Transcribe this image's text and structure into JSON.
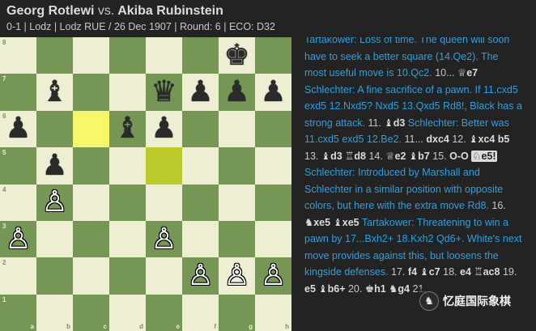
{
  "header": {
    "white": "Georg Rotlewi",
    "vs": "vs.",
    "black": "Akiba Rubinstein",
    "meta": "0-1 | Lodz | Lodz RUE / 26 Dec 1907 | Round: 6 | ECO: D32"
  },
  "board": {
    "ranks": [
      "8",
      "7",
      "6",
      "5",
      "4",
      "3",
      "2",
      "1"
    ],
    "files": [
      "a",
      "b",
      "c",
      "d",
      "e",
      "f",
      "g",
      "h"
    ],
    "highlighted": [
      "c6",
      "e5"
    ],
    "pieces": [
      {
        "square": "g8",
        "piece": "k",
        "color": "black",
        "glyph": "♚"
      },
      {
        "square": "b7",
        "piece": "b",
        "color": "black",
        "glyph": "♝"
      },
      {
        "square": "e7",
        "piece": "q",
        "color": "black",
        "glyph": "♛"
      },
      {
        "square": "f7",
        "piece": "p",
        "color": "black",
        "glyph": "♟"
      },
      {
        "square": "g7",
        "piece": "p",
        "color": "black",
        "glyph": "♟"
      },
      {
        "square": "h7",
        "piece": "p",
        "color": "black",
        "glyph": "♟"
      },
      {
        "square": "a6",
        "piece": "p",
        "color": "black",
        "glyph": "♟"
      },
      {
        "square": "d6",
        "piece": "b",
        "color": "black",
        "glyph": "♝"
      },
      {
        "square": "e6",
        "piece": "p",
        "color": "black",
        "glyph": "♟"
      },
      {
        "square": "b5",
        "piece": "p",
        "color": "black",
        "glyph": "♟"
      },
      {
        "square": "b4",
        "piece": "p",
        "color": "white",
        "glyph": "♙"
      },
      {
        "square": "a3",
        "piece": "p",
        "color": "white",
        "glyph": "♙"
      },
      {
        "square": "e3",
        "piece": "p",
        "color": "white",
        "glyph": "♙"
      },
      {
        "square": "f2",
        "piece": "p",
        "color": "white",
        "glyph": "♙"
      },
      {
        "square": "g2",
        "piece": "p",
        "color": "white",
        "glyph": "♙"
      },
      {
        "square": "h2",
        "piece": "p",
        "color": "white",
        "glyph": "♙"
      }
    ]
  },
  "notation": {
    "p1": "Tartakower: Loss of time. The queen will soon have to seek a better square (14.Qe2). The most useful move is 10.Qc2.",
    "n10": "10...",
    "m10b_fig": "♕",
    "m10b": "e7",
    "p2": "Schlechter: A fine sacrifice of a pawn. If 11.cxd5 exd5 12.Nxd5? Nxd5 13.Qxd5 Rd8!, Black has a strong attack.",
    "n11": "11.",
    "m11w_fig": "♝",
    "m11w": "d3",
    "p3": "Schlechter: Better was 11.cxd5 exd5 12.Be2.",
    "n11b": "11...",
    "m11b": "dxc4",
    "n12": "12.",
    "m12w_fig": "♝",
    "m12w": "xc4",
    "m12b": "b5",
    "n13": "13.",
    "m13w_fig": "♝",
    "m13w": "d3",
    "m13b_fig": "♖",
    "m13b": "d8",
    "n14": "14.",
    "m14w_fig": "♕",
    "m14w": "e2",
    "m14b_fig": "♝",
    "m14b": "b7",
    "n15": "15.",
    "m15w": "O-O",
    "m15b_fig": "♘",
    "m15b": "e5!",
    "p4": "Schlechter: Introduced by Marshall and Schlechter in a similar position with opposite colors, but here with the extra move Rd8.",
    "n16": "16.",
    "m16w_fig": "♞",
    "m16w": "xe5",
    "m16b_fig": "♝",
    "m16b": "xe5",
    "p5": "Tartakower: Threatening to win a pawn by 17...Bxh2+ 18.Kxh2 Qd6+. White's next move provides against this, but loosens the kingside defenses.",
    "n17": "17.",
    "m17w": "f4",
    "m17b_fig": "♝",
    "m17b": "c7",
    "n18": "18.",
    "m18w": "e4",
    "m18b_fig": "♖",
    "m18b": "ac8",
    "n19": "19.",
    "m19w": "e5",
    "m19b_fig": "♝",
    "m19b": "b6+",
    "n20": "20.",
    "m20w_fig": "♚",
    "m20w": "h1",
    "m20b_fig": "♞",
    "m20b": "g4",
    "n21": "21."
  },
  "watermark": {
    "logo": "♞",
    "text": "忆庭国际象棋"
  }
}
